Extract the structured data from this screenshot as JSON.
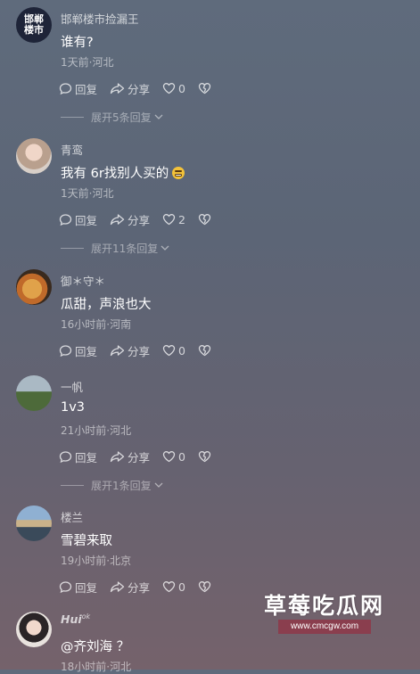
{
  "actions": {
    "reply": "回复",
    "share": "分享"
  },
  "comments": [
    {
      "user": "邯郸楼市捡漏王",
      "avatar_text": "邯郸楼市",
      "text": "谁有?",
      "meta": "1天前·河北",
      "likes": "0",
      "expand": "展开5条回复"
    },
    {
      "user": "青鸾",
      "text": "我有 6r找别人买的",
      "meta": "1天前·河北",
      "likes": "2",
      "expand": "展开11条回复"
    },
    {
      "user": "御＊守＊",
      "text": "瓜甜，声浪也大",
      "meta": "16小时前·河南",
      "likes": "0"
    },
    {
      "user": "一帆",
      "text": "1v3",
      "meta": "21小时前·河北",
      "likes": "0",
      "expand": "展开1条回复"
    },
    {
      "user": "楼兰",
      "text": "雪碧来取",
      "meta": "19小时前·北京",
      "likes": "0"
    },
    {
      "user": "Hui",
      "user_sup": "ok",
      "text": "@齐刘海 ？",
      "meta": "18小时前·河北"
    }
  ],
  "watermark": {
    "title": "草莓吃瓜网",
    "url": "www.cmcgw.com"
  }
}
